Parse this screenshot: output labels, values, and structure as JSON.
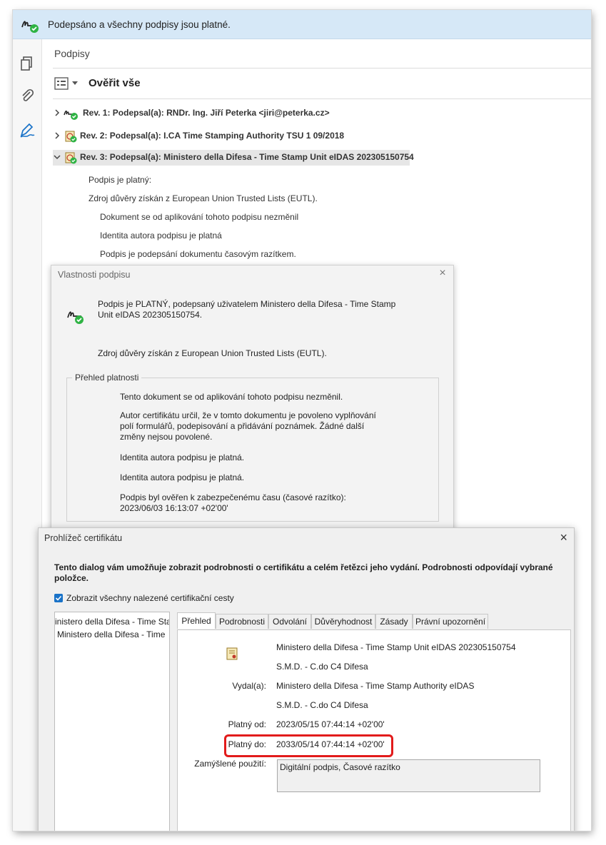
{
  "banner": {
    "text": "Podepsáno a všechny podpisy jsou platné."
  },
  "panel": {
    "title": "Podpisy",
    "verify_all": "Ověřit vše"
  },
  "revisions": [
    {
      "label": "Rev. 1: Podepsal(a): RNDr. Ing. Jiří Peterka <jiri@peterka.cz>"
    },
    {
      "label": "Rev. 2: Podepsal(a): I.CA Time Stamping Authority TSU 1 09/2018"
    },
    {
      "label": "Rev. 3: Podepsal(a): Ministero della Difesa - Time Stamp Unit eIDAS 202305150754"
    }
  ],
  "rev3_details": {
    "valid": "Podpis je platný:",
    "source": "Zdroj důvěry získán z European Union Trusted Lists (EUTL).",
    "unchanged": "Dokument se od aplikování tohoto podpisu nezměnil",
    "identity": "Identita autora podpisu je platná",
    "timestamp": "Podpis je podepsání dokumentu časovým razítkem."
  },
  "signature_properties": {
    "title": "Vlastnosti podpisu",
    "message": "Podpis je PLATNÝ, podepsaný uživatelem Ministero della Difesa - Time Stamp Unit eIDAS 202305150754.",
    "source": "Zdroj důvěry získán z European Union Trusted Lists (EUTL).",
    "group_title": "Přehled platnosti",
    "lines": [
      "Tento dokument se od aplikování tohoto podpisu nezměnil.",
      "Autor certifikátu určil, že v tomto dokumentu je povoleno vyplňování polí formulářů, podepisování a přidávání poznámek. Žádné další změny nejsou povolené.",
      "Identita autora podpisu je platná.",
      "Identita autora podpisu je platná.",
      "Podpis byl ověřen k zabezpečenému času (časové razítko): 2023/06/03 16:13:07 +02'00'"
    ]
  },
  "certificate_viewer": {
    "title": "Prohlížeč certifikátu",
    "intro": "Tento dialog vám umožňuje zobrazit podrobnosti o certifikátu a celém řetězci jeho vydání. Podrobnosti odpovídají vybrané položce.",
    "show_all_paths": "Zobrazit všechny nalezené certifikační cesty",
    "tree": [
      "inistero della Difesa - Time Star",
      "Ministero della Difesa - Time"
    ],
    "tabs": [
      "Přehled",
      "Podrobnosti",
      "Odvolání",
      "Důvěryhodnost",
      "Zásady",
      "Právní upozornění"
    ],
    "subject_name": "Ministero della Difesa - Time Stamp Unit eIDAS 202305150754",
    "subject_org": "S.M.D. - C.do C4 Difesa",
    "issuer_label": "Vydal(a):",
    "issuer_name": "Ministero della Difesa - Time Stamp Authority eIDAS",
    "issuer_org": "S.M.D. - C.do C4 Difesa",
    "valid_from_label": "Platný od:",
    "valid_from": "2023/05/15 07:44:14 +02'00'",
    "valid_to_label": "Platný do:",
    "valid_to": "2033/05/14 07:44:14 +02'00'",
    "usage_label": "Zamýšlené použití:",
    "usage": "Digitální podpis, Časové razítko"
  },
  "colors": {
    "banner": "#d6e8f7",
    "accent": "#1a73c8",
    "highlight": "#e21b1b",
    "ok": "#2fb344"
  }
}
